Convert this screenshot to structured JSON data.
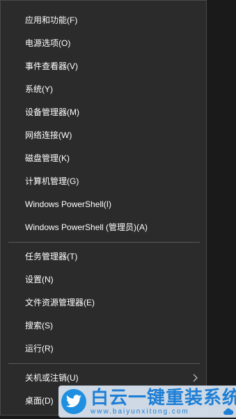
{
  "menu": {
    "items": [
      {
        "label": "应用和功能(F)"
      },
      {
        "label": "电源选项(O)"
      },
      {
        "label": "事件查看器(V)"
      },
      {
        "label": "系统(Y)"
      },
      {
        "label": "设备管理器(M)"
      },
      {
        "label": "网络连接(W)"
      },
      {
        "label": "磁盘管理(K)"
      },
      {
        "label": "计算机管理(G)"
      },
      {
        "label": "Windows PowerShell(I)"
      },
      {
        "label": "Windows PowerShell (管理员)(A)"
      },
      {
        "label": "任务管理器(T)"
      },
      {
        "label": "设置(N)"
      },
      {
        "label": "文件资源管理器(E)"
      },
      {
        "label": "搜索(S)"
      },
      {
        "label": "运行(R)"
      },
      {
        "label": "关机或注销(U)",
        "submenu_icon": "chevron-right-icon"
      },
      {
        "label": "桌面(D)"
      }
    ]
  },
  "watermark": {
    "title": "白云一键重装系统",
    "url": "www.baiyunxitong.com",
    "logo_icon": "bird-icon",
    "color": "#1e7fd6"
  },
  "colors": {
    "menu_background": "#2b2b2b",
    "text": "#ffffff",
    "separator": "#5a5a5a"
  }
}
